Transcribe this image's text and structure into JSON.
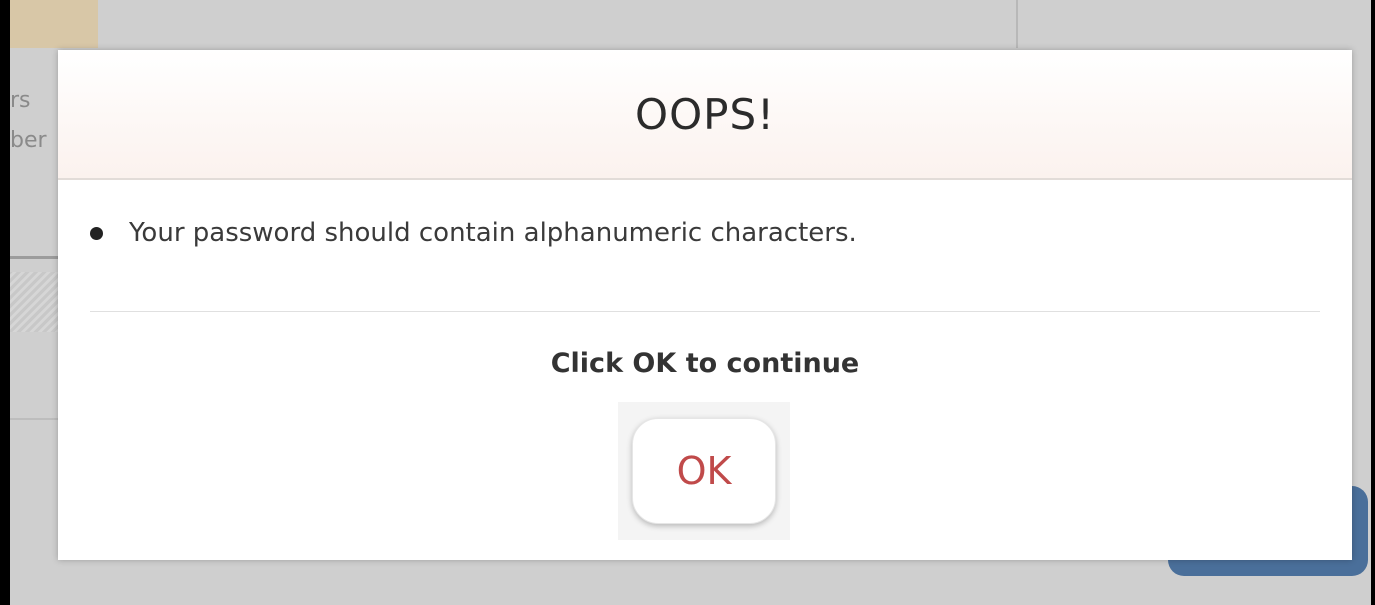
{
  "dialog": {
    "title": "OOPS!",
    "message": "Your password should contain alphanumeric characters.",
    "instruction": "Click OK to continue",
    "ok_label": "OK"
  },
  "background": {
    "fragment_1": "rs",
    "fragment_2": "ber"
  },
  "colors": {
    "ok_text": "#c04a4a",
    "header_tint": "#fbf2ee",
    "backdrop": "#cfcfcf",
    "background_button": "#4a6f9a"
  },
  "icons": {
    "bullet": "bullet-icon"
  }
}
